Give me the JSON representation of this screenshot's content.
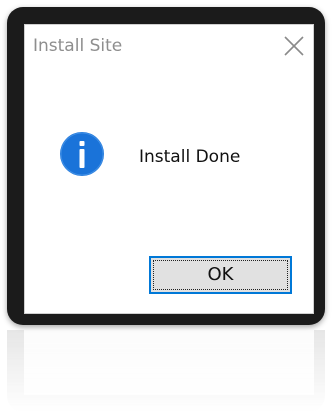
{
  "window": {
    "title": "Install Site"
  },
  "message": {
    "text": "Install Done",
    "icon": "info-icon"
  },
  "buttons": {
    "ok_label": "OK"
  },
  "colors": {
    "accent": "#0078d7",
    "info_icon": "#1a73d9",
    "title_text": "#8e8e8e",
    "frame": "#1b1b1b"
  }
}
